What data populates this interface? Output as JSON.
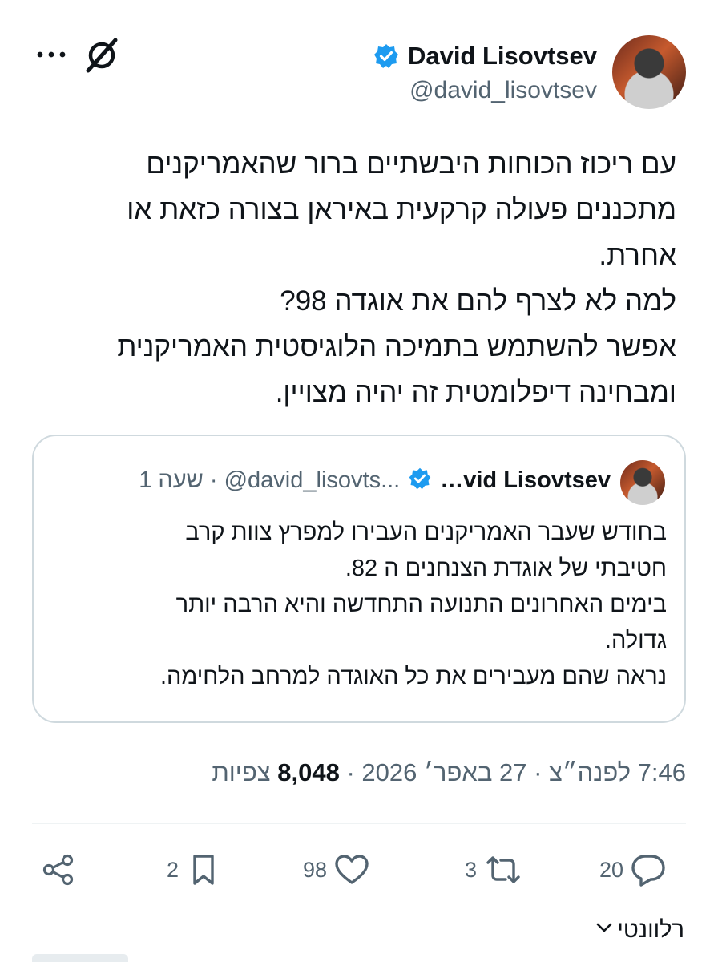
{
  "tweet": {
    "author_name": "David Lisovtsev",
    "author_handle": "@david_lisovtsev",
    "body_lines": [
      "עם ריכוז הכוחות היבשתיים ברור שהאמריקנים",
      "מתכננים פעולה קרקעית באיראן בצורה כזאת או",
      "אחרת.",
      "למה לא לצרף להם את אוגדה 98?",
      "אפשר להשתמש בתמיכה הלוגיסטית האמריקנית",
      "ומבחינה דיפלומטית זה יהיה מצויין."
    ],
    "timestamp": "7:46 לפנה״צ · 27 באפר׳ 2026 · ",
    "views_count": "8,048",
    "views_label": " צפיות"
  },
  "quote": {
    "author_name": "…vid Lisovtsev",
    "meta": "1 שעה · @david_lisovts...",
    "body_lines": [
      "בחודש שעבר האמריקנים העבירו למפרץ צוות קרב",
      "חטיבתי של אוגדת הצנחנים ה 82.",
      "בימים האחרונים התנועה התחדשה והיא הרבה יותר",
      "גדולה.",
      "נראה שהם מעבירים את כל האוגדה למרחב הלחימה."
    ]
  },
  "actions": {
    "replies": "20",
    "reposts": "3",
    "likes": "98",
    "bookmarks": "2"
  },
  "relevant_label": "רלוונטי",
  "colors": {
    "verified": "#1d9bf0",
    "text": "#0f1419",
    "secondary": "#536471",
    "border": "#cfd9de"
  },
  "icons": [
    "more-icon",
    "grok-icon",
    "verified-icon",
    "reply-icon",
    "repost-icon",
    "like-icon",
    "bookmark-icon",
    "share-icon",
    "chevron-down-icon"
  ]
}
